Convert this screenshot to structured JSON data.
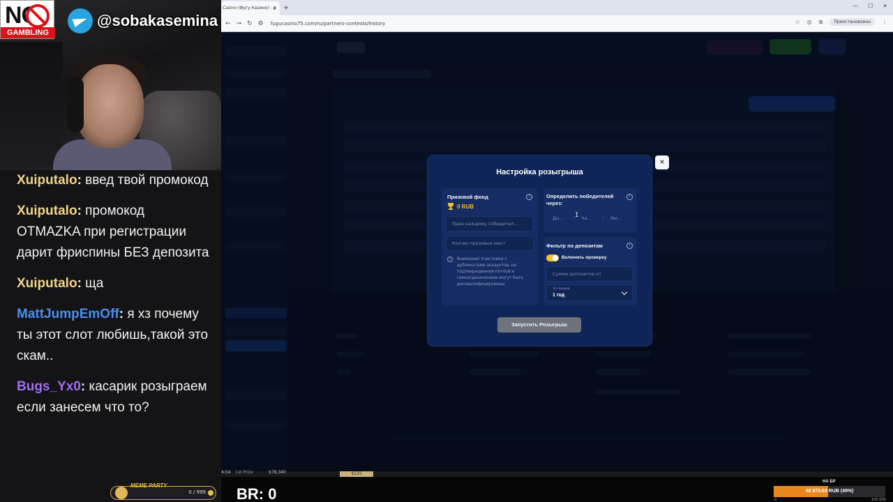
{
  "overlay": {
    "no_text": "NO",
    "gambling_label": "GAMBLING",
    "telegram_handle": "@sobakasemina"
  },
  "chat": {
    "messages": [
      {
        "user": "Xuiputalo",
        "color": "#f1d38a",
        "text": "введ твой промокод"
      },
      {
        "user": "Xuiputalo",
        "color": "#f1d38a",
        "text": "промокод OTMAZKA при регистрации дарит фриспины БЕЗ депозита"
      },
      {
        "user": "Xuiputalo",
        "color": "#f1d38a",
        "text": "ща"
      },
      {
        "user": "MattJumpEmOff",
        "color": "#4a8df0",
        "text": "я хз почему ты этот слот любишь,такой это скам.."
      },
      {
        "user": "Bugs_Yx0",
        "color": "#a06ef2",
        "text": "касарик розыграем если занесем что то?"
      }
    ],
    "meme_label": "MEME PARTY",
    "meme_count": "0 / 999"
  },
  "browser": {
    "tab_title": "Casino (Фугу Казино) - р",
    "url": "fugucasino75.com/ru/partners-contests/history",
    "paused_label": "Приостановлено"
  },
  "modal": {
    "title": "Настройка розыгрыша",
    "prize_card": {
      "title": "Призовой фонд",
      "value": "0 RUB",
      "prize_each_placeholder": "Приз каждому победител...",
      "places_placeholder": "Кол-во призовых мест",
      "warning": "Внимание! Участники с дубликатами аккаунтов, не подтвержденной почтой и самоогреничением могут быть дисквалифицированы."
    },
    "winners_card": {
      "title": "Определить победителей через:",
      "days_placeholder": "Дн...",
      "hours_placeholder": "Ча...",
      "minutes_placeholder": "Ми..."
    },
    "deposit_card": {
      "title": "Фильтр по депозитам",
      "toggle_label": "Включить проверку",
      "deposit_placeholder": "Сумма депозитов от",
      "period_label": "За период",
      "period_value": "1 год"
    },
    "launch_button": "Запустить Розыгрыш",
    "close_symbol": "×"
  },
  "bottom_bar": {
    "ticker_time": "4:54",
    "ticker_prize": "1st Prize",
    "ticker_value": "$78,340",
    "ticker_amount": "$125",
    "br_text": "BR: 0",
    "progress_title": "НА БР",
    "progress_text": "48 970.63 RUB (49%)",
    "progress_fraction": 0.49,
    "progress_min": "0",
    "progress_max": "100 000"
  }
}
